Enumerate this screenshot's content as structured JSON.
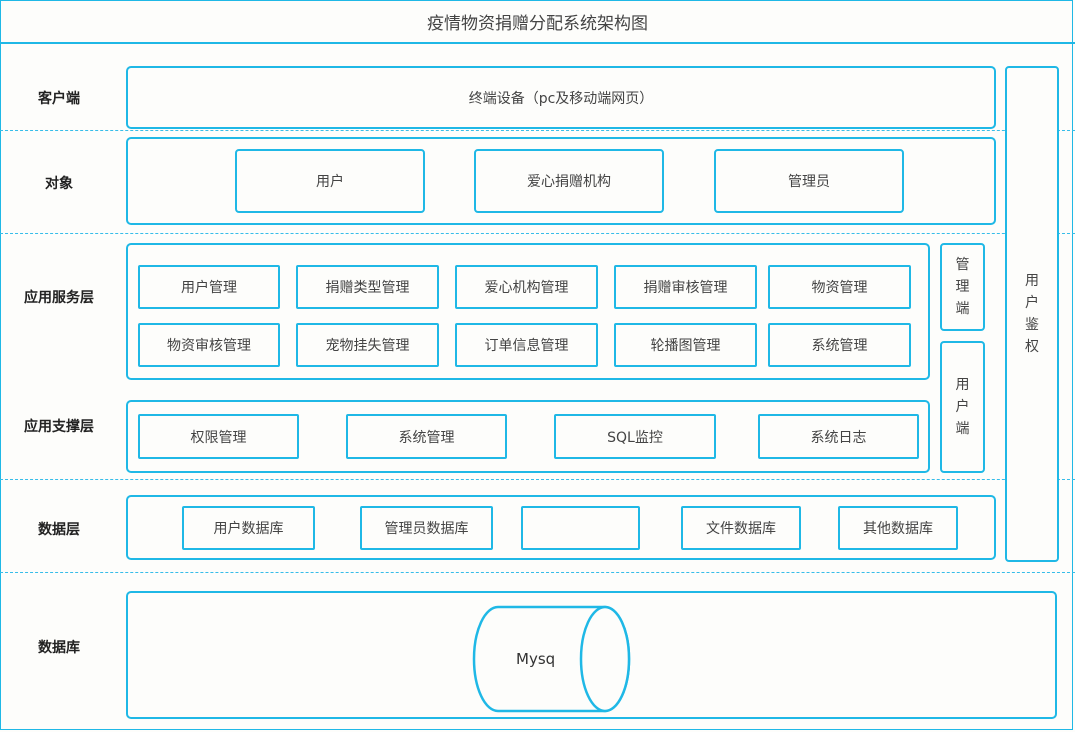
{
  "title": "疫情物资捐赠分配系统架构图",
  "rows": {
    "client": "客户端",
    "object": "对象",
    "service": "应用服务层",
    "support": "应用支撑层",
    "data": "数据层",
    "database": "数据库"
  },
  "client": {
    "terminal": "终端设备（pc及移动端网页）"
  },
  "objects": [
    "用户",
    "爱心捐赠机构",
    "管理员"
  ],
  "service": {
    "row1": [
      "用户管理",
      "捐赠类型管理",
      "爱心机构管理",
      "捐赠审核管理",
      "物资管理"
    ],
    "row2": [
      "物资审核管理",
      "宠物挂失管理",
      "订单信息管理",
      "轮播图管理",
      "系统管理"
    ]
  },
  "support": [
    "权限管理",
    "系统管理",
    "SQL监控",
    "系统日志"
  ],
  "data": [
    "用户数据库",
    "管理员数据库",
    "",
    "文件数据库",
    "其他数据库"
  ],
  "side": {
    "admin": "管理端",
    "user": "用户端",
    "auth": "用户鉴权"
  },
  "database": {
    "cylinder": "Mysq"
  },
  "colors": {
    "accent": "#1fb8e6",
    "background": "#fdfdfb"
  }
}
